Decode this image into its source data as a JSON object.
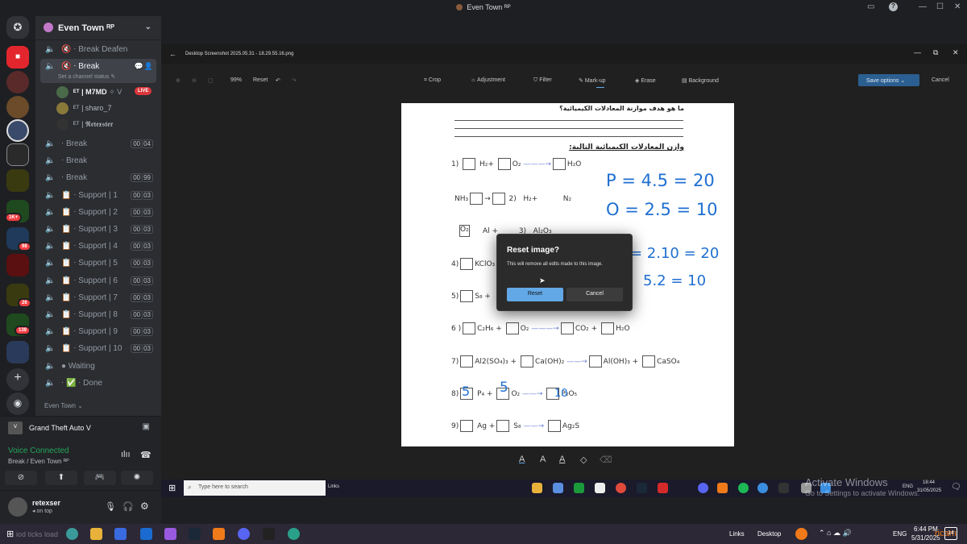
{
  "window": {
    "title": "Even Town ᴿᴾ"
  },
  "server": {
    "name": "Even Town ᴿᴾ",
    "footer": "Even Town ⌄"
  },
  "server_badges": [
    "1K+",
    "98",
    "26",
    "139"
  ],
  "channels": [
    {
      "name": "Break Deafen",
      "prefix": "🔇 ⋅ ",
      "count": null
    },
    {
      "name": "Break",
      "prefix": "🔇 ⋅ ",
      "count": null,
      "active": true,
      "status": "Set a channel status ✎"
    },
    {
      "name": "Break",
      "prefix": "⋅ ",
      "count": [
        "00",
        "04"
      ]
    },
    {
      "name": "Break",
      "prefix": "⋅ ",
      "count": null
    },
    {
      "name": "Break",
      "prefix": "⋅ ",
      "count": [
        "00",
        "99"
      ]
    },
    {
      "name": "Support | 1",
      "prefix": "📋 ⋅ ",
      "count": [
        "00",
        "03"
      ]
    },
    {
      "name": "Support | 2",
      "prefix": "📋 ⋅ ",
      "count": [
        "00",
        "03"
      ]
    },
    {
      "name": "Support | 3",
      "prefix": "📋 ⋅ ",
      "count": [
        "00",
        "03"
      ]
    },
    {
      "name": "Support | 4",
      "prefix": "📋 ⋅ ",
      "count": [
        "00",
        "03"
      ]
    },
    {
      "name": "Support | 5",
      "prefix": "📋 ⋅ ",
      "count": [
        "00",
        "03"
      ]
    },
    {
      "name": "Support | 6",
      "prefix": "📋 ⋅ ",
      "count": [
        "00",
        "03"
      ]
    },
    {
      "name": "Support | 7",
      "prefix": "📋 ⋅ ",
      "count": [
        "00",
        "03"
      ]
    },
    {
      "name": "Support | 8",
      "prefix": "📋 ⋅ ",
      "count": [
        "00",
        "03"
      ]
    },
    {
      "name": "Support | 9",
      "prefix": "📋 ⋅ ",
      "count": [
        "00",
        "03"
      ]
    },
    {
      "name": "Support | 10",
      "prefix": "📋 ⋅ ",
      "count": [
        "00",
        "03"
      ]
    },
    {
      "name": "Waiting",
      "prefix": "● ",
      "count": null
    },
    {
      "name": "Done",
      "prefix": "⋅ ✅ ⋅ ",
      "count": null
    }
  ],
  "voice_users": [
    {
      "name": "ᴱᵀ | M7MD",
      "extra": "✧ V",
      "live": "LIVE"
    },
    {
      "name": "ᴱᵀ | sharo_7"
    },
    {
      "name": "ᴱᵀ | 𝕽𝖊𝖙𝖊𝖝𝖘𝖙𝖊𝖗"
    }
  ],
  "activity": {
    "game": "Grand Theft Auto V"
  },
  "voice": {
    "status": "Voice Connected",
    "channel": "Break / Even Town ᴿᴾ"
  },
  "user": {
    "name": "retexser",
    "status": "on top"
  },
  "editor": {
    "file": "Desktop Screenshot 2025.05.31 - 18.29.55.16.png",
    "zoom": "99%",
    "reset": "Reset",
    "tools": [
      "Crop",
      "Adjustment",
      "Filter",
      "Mark-up",
      "Erase",
      "Background"
    ],
    "save": "Save options",
    "cancel": "Cancel"
  },
  "worksheet": {
    "question": "ما هو هدف موازنة المعادلات الكيميائية؟",
    "heading": "وازن المعادلات الكيميائية التالية:",
    "eq1": [
      "1)",
      "H₂+",
      "O₂",
      "H₂O"
    ],
    "eq2": [
      "NH₃",
      "2)",
      "H₂+",
      "N₂"
    ],
    "eq3": [
      "O₂",
      "Al +",
      "3)",
      "Al₂O₃"
    ],
    "eq4": [
      "4)",
      "KClO₃"
    ],
    "eq5": [
      "5)",
      "S₈ +"
    ],
    "eq6": [
      "6 )",
      "C₂H₆",
      "+",
      "O₂",
      "CO₂ +",
      "H₂O"
    ],
    "eq7": [
      "7)",
      "Al2(SO₄)₃",
      "+",
      "Ca(OH)₂",
      "Al(OH)₃ +",
      "CaSO₄"
    ],
    "eq8": [
      "8)",
      "P₄ +",
      "O₂",
      "P₂O₅"
    ],
    "eq9": [
      "9)",
      "Ag",
      "+",
      "S₈",
      "Ag₂S"
    ],
    "handwriting": [
      "P = 4.5 = 20",
      "O = 2.5 = 10",
      "= 2.10 = 20",
      "5.2 = 10",
      "5",
      "5",
      "10"
    ]
  },
  "dialog": {
    "title": "Reset image?",
    "message": "This will remove all edits made to this image.",
    "confirm": "Reset",
    "cancel": "Cancel"
  },
  "taskbar_inner": {
    "search": "Type here to search",
    "links": "Links",
    "lang": "ENG",
    "time": "18:44",
    "date": "31/05/2025",
    "watermark1": "Activate Windows",
    "watermark2": "Go to Settings to activate Windows."
  },
  "taskbar_outer": {
    "left": "iod ticks load",
    "links": "Links",
    "desktop": "Desktop",
    "lang": "ENG",
    "time": "6:44 PM",
    "date": "5/31/2025",
    "notif": "14",
    "overlay": "ricam"
  },
  "colors": {
    "accent": "#5865f2",
    "live": "#da373c",
    "voice": "#23a559",
    "dialog_primary": "#62a8e6",
    "handwriting": "#1f6fd1"
  }
}
